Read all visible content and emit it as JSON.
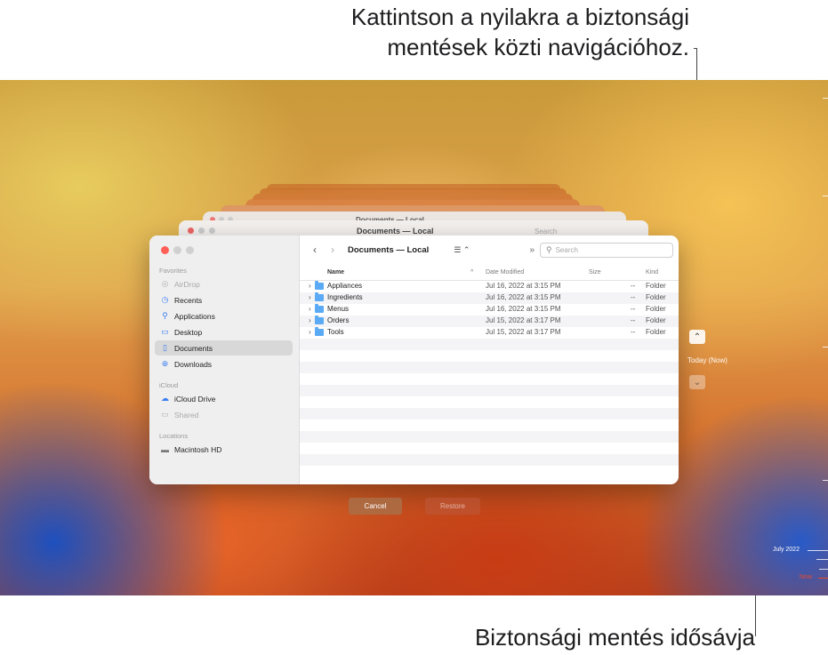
{
  "callouts": {
    "top_line1": "Kattintson a nyilakra a biztonsági",
    "top_line2": "mentések közti navigációhoz.",
    "bottom": "Biztonsági mentés idősávja"
  },
  "window": {
    "title": "Documents — Local",
    "back_icon": "chevron-left-icon",
    "forward_icon": "chevron-right-icon",
    "view_icon": "list-view-icon",
    "view_label": "☰ ⌃",
    "more_label": "»",
    "search_placeholder": "Search"
  },
  "sidebar": {
    "favorites_heading": "Favorites",
    "favorites": [
      {
        "label": "AirDrop",
        "icon": "airdrop-icon",
        "dim": true
      },
      {
        "label": "Recents",
        "icon": "clock-icon"
      },
      {
        "label": "Applications",
        "icon": "applications-icon"
      },
      {
        "label": "Desktop",
        "icon": "desktop-icon"
      },
      {
        "label": "Documents",
        "icon": "document-icon",
        "selected": true
      },
      {
        "label": "Downloads",
        "icon": "download-icon"
      }
    ],
    "icloud_heading": "iCloud",
    "icloud": [
      {
        "label": "iCloud Drive",
        "icon": "cloud-icon"
      },
      {
        "label": "Shared",
        "icon": "shared-folder-icon",
        "dim": true
      }
    ],
    "locations_heading": "Locations",
    "locations": [
      {
        "label": "Macintosh HD",
        "icon": "disk-icon"
      }
    ]
  },
  "table": {
    "columns": {
      "name": "Name",
      "date": "Date Modified",
      "size": "Size",
      "kind": "Kind"
    },
    "sort_indicator": "^",
    "rows": [
      {
        "name": "Appliances",
        "date": "Jul 16, 2022 at 3:15 PM",
        "size": "--",
        "kind": "Folder"
      },
      {
        "name": "Ingredients",
        "date": "Jul 16, 2022 at 3:15 PM",
        "size": "--",
        "kind": "Folder"
      },
      {
        "name": "Menus",
        "date": "Jul 16, 2022 at 3:15 PM",
        "size": "--",
        "kind": "Folder"
      },
      {
        "name": "Orders",
        "date": "Jul 15, 2022 at 3:17 PM",
        "size": "--",
        "kind": "Folder"
      },
      {
        "name": "Tools",
        "date": "Jul 15, 2022 at 3:17 PM",
        "size": "--",
        "kind": "Folder"
      }
    ]
  },
  "buttons": {
    "cancel": "Cancel",
    "restore": "Restore"
  },
  "navigation": {
    "up_icon": "chevron-up-icon",
    "down_icon": "chevron-down-icon",
    "current": "Today (Now)"
  },
  "timeline": {
    "month": "July 2022",
    "now": "Now"
  },
  "colors": {
    "close": "#ff5f57",
    "inactive_dot": "#d0d0d0",
    "accent": "#3a7ef0",
    "timeline_now": "#e84a2a"
  }
}
